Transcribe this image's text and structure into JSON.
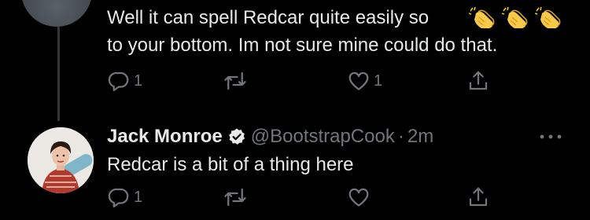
{
  "tweet1": {
    "line1": "Well it can spell Redcar quite easily so",
    "line2": "to your bottom. Im not sure mine could do that.",
    "emojis": [
      "clapping-hands-emoji",
      "clapping-hands-emoji",
      "clapping-hands-emoji"
    ],
    "reply_count": "1",
    "like_count": "1"
  },
  "tweet2": {
    "display_name": "Jack Monroe",
    "handle": "@BootstrapCook",
    "separator": "·",
    "time": "2m",
    "text": "Redcar is a bit of a thing here",
    "reply_count": "1"
  },
  "colors": {
    "background": "#000000",
    "text": "#e7e9ea",
    "muted": "#71767b",
    "thread_line": "#333639"
  },
  "icons": {
    "reply": "reply-icon",
    "retweet": "retweet-icon",
    "like": "heart-icon",
    "share": "share-icon",
    "verified": "verified-badge-icon",
    "more": "more-dots-icon"
  }
}
